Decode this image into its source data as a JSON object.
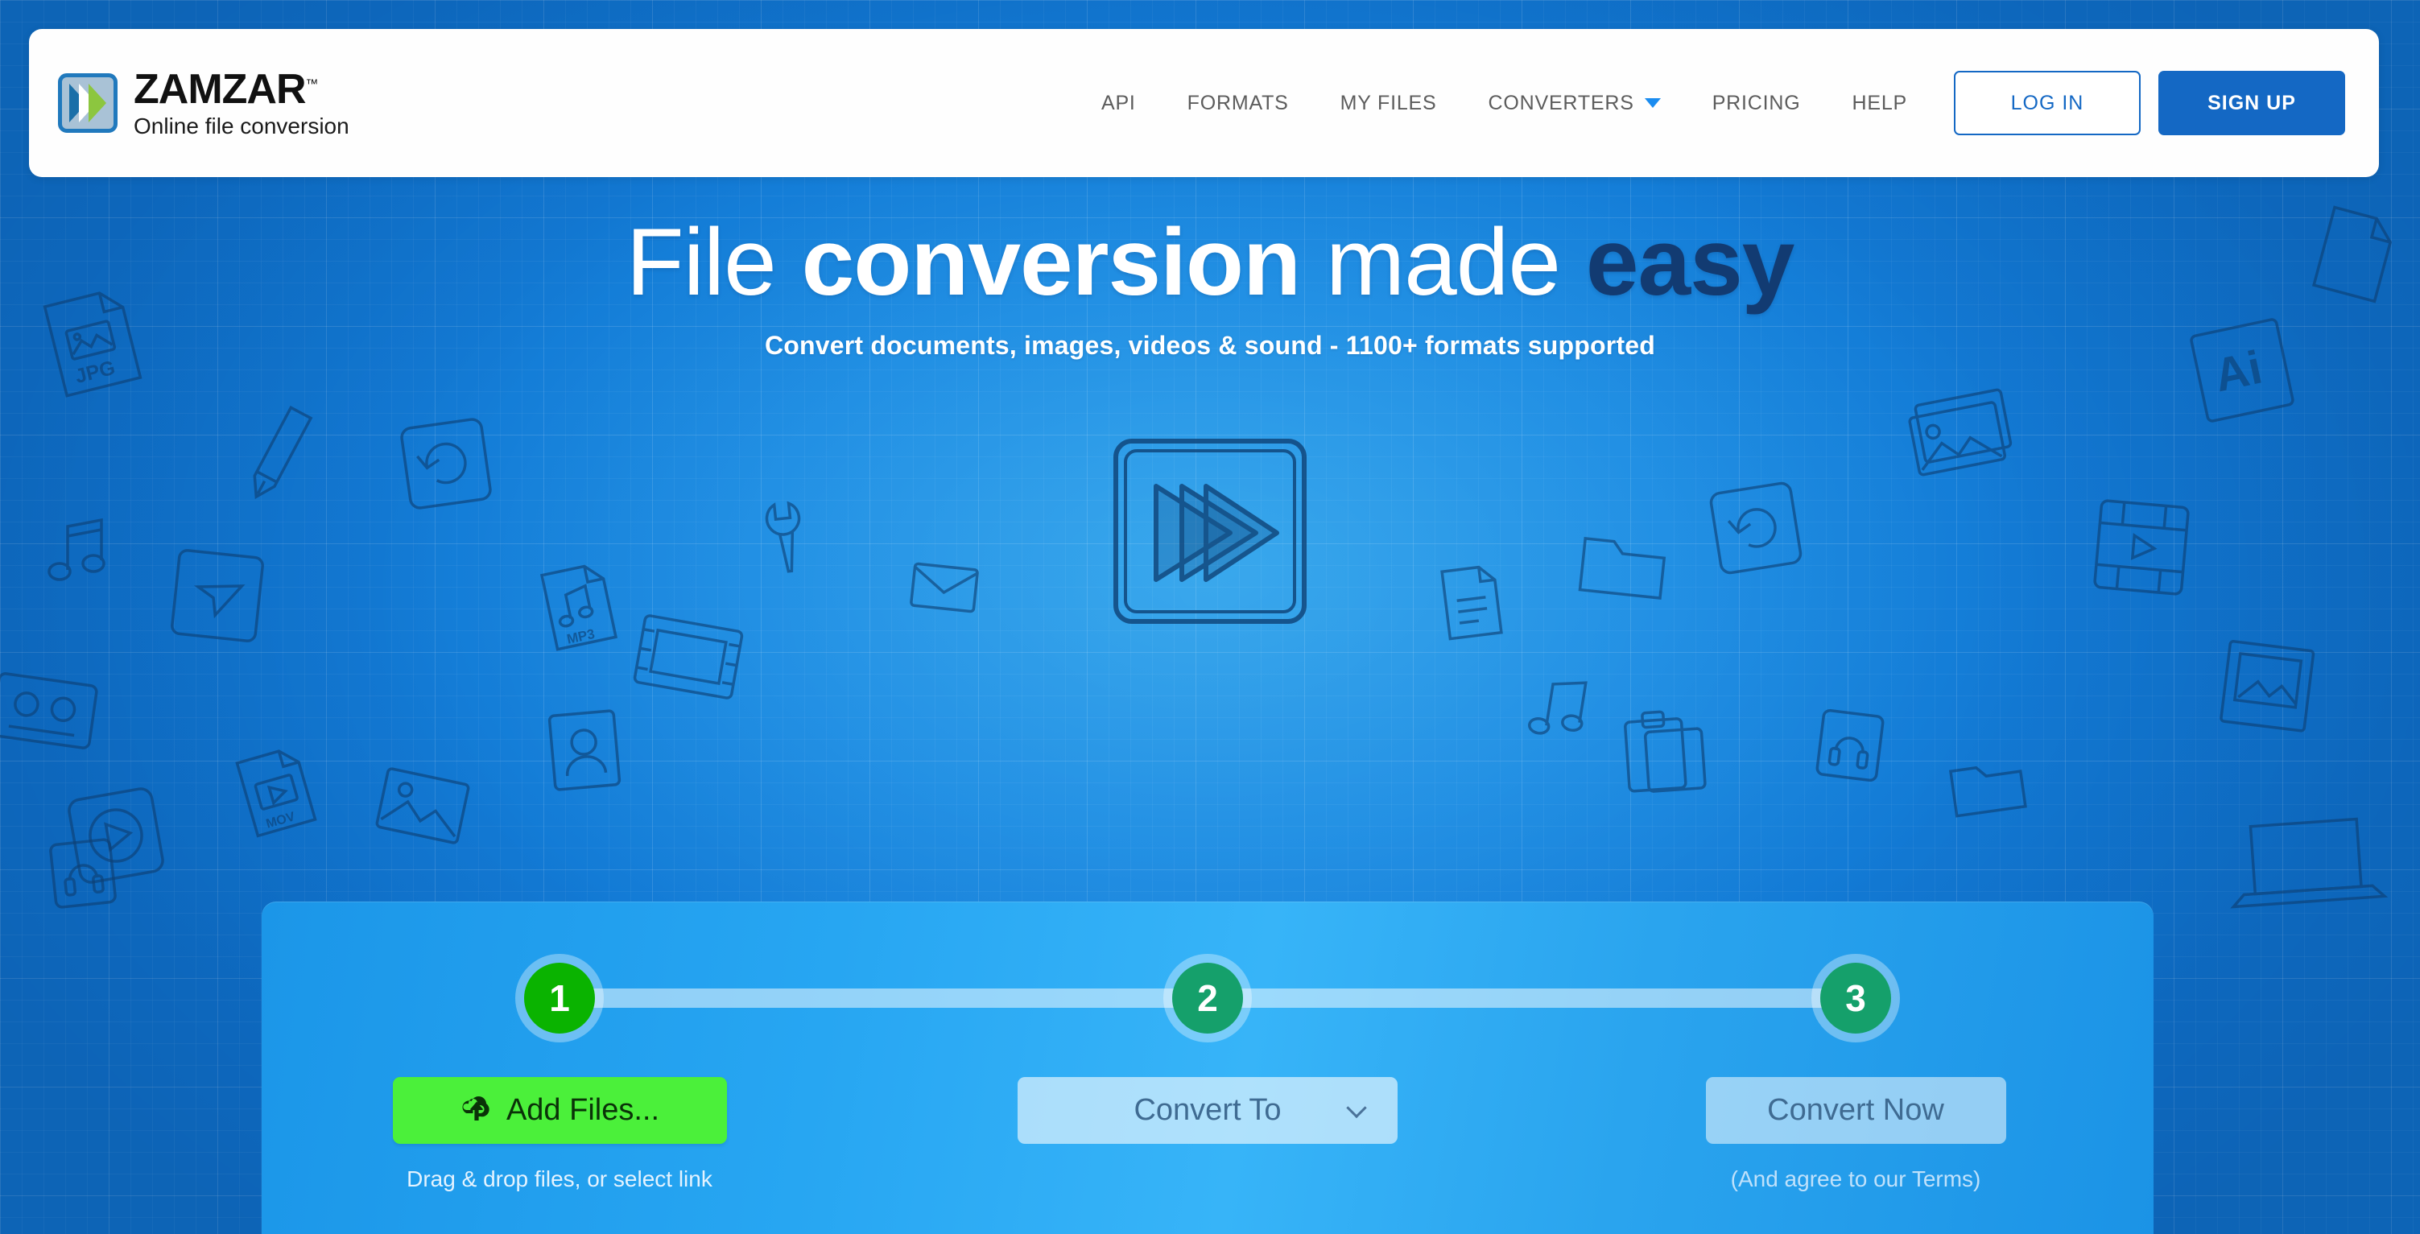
{
  "brand": {
    "name": "ZAMZAR",
    "tm": "™",
    "tagline": "Online file conversion",
    "logo_icon": "double-chevron-logo-icon",
    "colors": {
      "logo_border": "#2079bd",
      "logo_fill": "#a9c2d6",
      "chevron_blue": "#1a6fa8",
      "chevron_white": "#ffffff",
      "chevron_green": "#8cc63f"
    }
  },
  "nav": {
    "items": [
      {
        "label": "API",
        "name": "nav-api",
        "has_caret": false
      },
      {
        "label": "FORMATS",
        "name": "nav-formats",
        "has_caret": false
      },
      {
        "label": "MY FILES",
        "name": "nav-my-files",
        "has_caret": false
      },
      {
        "label": "CONVERTERS",
        "name": "nav-converters",
        "has_caret": true
      },
      {
        "label": "PRICING",
        "name": "nav-pricing",
        "has_caret": false
      },
      {
        "label": "HELP",
        "name": "nav-help",
        "has_caret": false
      }
    ],
    "login_label": "LOG IN",
    "signup_label": "SIGN UP",
    "caret_icon": "chevron-down-icon",
    "accent": "#1468c4",
    "caret_color": "#1a8cf0"
  },
  "hero": {
    "headline_part1": "File ",
    "headline_part2": "conversion",
    "headline_part3": " made ",
    "headline_part4": "easy",
    "subheadline": "Convert documents, images, videos & sound - 1100+ formats supported",
    "easy_color": "#123b72",
    "graphic_icon": "fast-forward-sketch-icon"
  },
  "converter": {
    "steps": [
      {
        "number": "1",
        "name": "step-1",
        "color": "#0ab300",
        "state": "active"
      },
      {
        "number": "2",
        "name": "step-2",
        "color": "#15a06b",
        "state": "inactive"
      },
      {
        "number": "3",
        "name": "step-3",
        "color": "#15a06b",
        "state": "inactive"
      }
    ],
    "add_files_label": "Add Files...",
    "add_files_icon": "cloud-upload-icon",
    "add_files_hint": "Drag & drop files, or select link",
    "convert_to_label": "Convert To",
    "convert_to_icon": "chevron-down-icon",
    "convert_now_label": "Convert Now",
    "convert_now_hint": "(And agree to our Terms)",
    "add_files_color": "#4bf03a",
    "panel_color": "#27a6f2"
  },
  "background": {
    "base_color": "#1678d4",
    "sketch_icons": [
      "jpg-file-icon",
      "pencil-icon",
      "music-note-icon",
      "refresh-icon",
      "image-frame-icon",
      "wrench-icon",
      "send-icon",
      "envelope-icon",
      "mp3-file-icon",
      "film-strip-icon",
      "contact-card-icon",
      "mov-file-icon",
      "picture-icon",
      "play-circle-icon",
      "cassette-icon",
      "document-icon",
      "folder-icon",
      "clipboard-icon",
      "headphones-icon",
      "ai-file-icon",
      "photos-stack-icon",
      "video-grid-icon",
      "laptop-icon",
      "polaroid-icon"
    ]
  }
}
